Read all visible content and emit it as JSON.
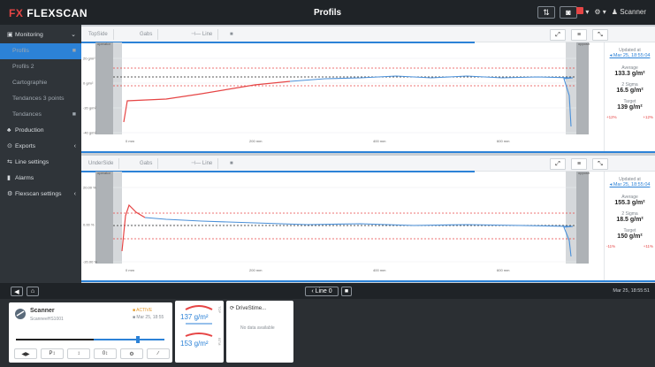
{
  "app": {
    "logo_prefix": "FX",
    "logo_name": "FLEXSCAN",
    "page_title": "Profils"
  },
  "topbar": {
    "user": "Scanner",
    "flag_label": "▾",
    "gear_label": "⚙ ▾"
  },
  "sidebar": {
    "items": [
      {
        "label": "Monitoring",
        "icon": "monitor-icon",
        "active": false,
        "sub": false,
        "right": "⌄"
      },
      {
        "label": "Profils",
        "icon": "",
        "active": true,
        "sub": true,
        "right": "■"
      },
      {
        "label": "Profils 2",
        "icon": "",
        "active": false,
        "sub": true,
        "right": ""
      },
      {
        "label": "Cartographie",
        "icon": "",
        "active": false,
        "sub": true,
        "right": ""
      },
      {
        "label": "Tendances 3 points",
        "icon": "",
        "active": false,
        "sub": true,
        "right": ""
      },
      {
        "label": "Tendances",
        "icon": "",
        "active": false,
        "sub": true,
        "right": "■"
      },
      {
        "label": "Production",
        "icon": "production-icon",
        "active": false,
        "sub": false,
        "right": ""
      },
      {
        "label": "Exports",
        "icon": "exports-icon",
        "active": false,
        "sub": false,
        "right": "‹"
      },
      {
        "label": "Line settings",
        "icon": "settings-icon",
        "active": false,
        "sub": false,
        "right": ""
      },
      {
        "label": "Alarms",
        "icon": "alarm-icon",
        "active": false,
        "sub": false,
        "right": ""
      },
      {
        "label": "Flexscan settings",
        "icon": "gear-icon",
        "active": false,
        "sub": false,
        "right": "‹"
      }
    ]
  },
  "panels": [
    {
      "tabs": [
        "TopSide",
        "Gabs",
        "⊣— Line",
        "■"
      ],
      "operator_label": "operator",
      "opposite_label": "opposite",
      "updated_label": "Updated at",
      "updated_value": "◂ Mar 25, 18:55:04",
      "average_label": "Average",
      "average_value": "133.3 g/m²",
      "sigma_label": "2 Sigma",
      "sigma_value": "16.5 g/m²",
      "target_label": "Target",
      "target_value": "139 g/m²",
      "tol_left": "+12%",
      "tol_right": "+12%",
      "y_ticks": [
        "20 g/m²",
        "0 g/m²",
        "-20 g/m²",
        "-40 g/m²"
      ],
      "x_ticks": [
        "0 mm",
        "200 mm",
        "400 mm",
        "600 mm"
      ]
    },
    {
      "tabs": [
        "UnderSide",
        "Gabs",
        "⊣— Line",
        "■"
      ],
      "operator_label": "operator",
      "opposite_label": "opposite",
      "updated_label": "Updated at",
      "updated_value": "◂ Mar 25, 18:55:04",
      "average_label": "Average",
      "average_value": "155.3 g/m²",
      "sigma_label": "2 Sigma",
      "sigma_value": "18.5 g/m²",
      "target_label": "Target",
      "target_value": "150 g/m²",
      "tol_left": "-11%",
      "tol_right": "+11%",
      "y_ticks": [
        "20.00 %",
        "0.00 %",
        "-20.00 %"
      ],
      "x_ticks": [
        "0 mm",
        "200 mm",
        "400 mm",
        "600 mm"
      ]
    }
  ],
  "statusbar": {
    "line_label": "‹ Line 0",
    "lock_label": "■",
    "time": "Mar 25, 18:55:51"
  },
  "bottom": {
    "scanner_title": "Scanner",
    "scanner_sub": "ScanneeHS1001",
    "scanner_status1": "■ ACTIVE",
    "scanner_status2": "■ Mar 25, 18:55",
    "gauge_top": "137 g/m²",
    "gauge_bottom": "153 g/m²",
    "gauge_tag": "TOP",
    "gauge_tag2": "BTM",
    "drive_title": "DriveStime...",
    "drive_sub": "No data available",
    "toolbar": [
      "◀▶",
      "P↕",
      "↕",
      "0↕",
      "⚙",
      "∕"
    ]
  }
}
